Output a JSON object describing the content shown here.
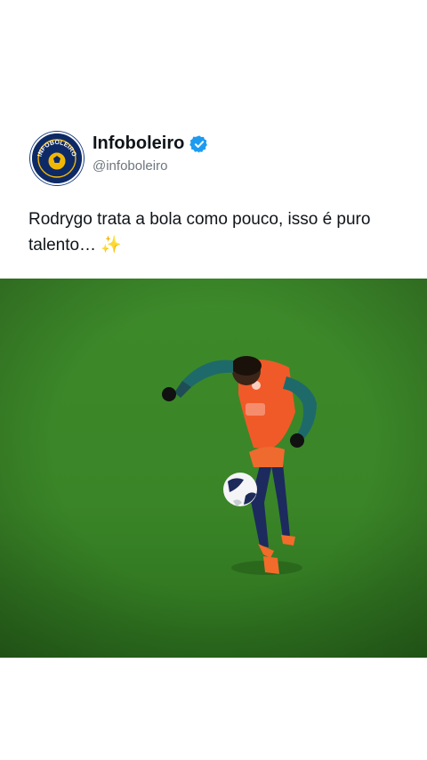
{
  "account": {
    "display_name": "Infoboleiro",
    "handle": "@infoboleiro",
    "verified": true,
    "avatar_icon": "infoboleiro-logo",
    "avatar_text": "INFOBOLEIRO"
  },
  "tweet": {
    "text": "Rodrygo trata a bola como pouco, isso é puro talento…",
    "emoji": "✨"
  },
  "media": {
    "description_icon": "football-player-juggling-image"
  },
  "colors": {
    "verified_badge": "#1d9bf0",
    "pitch_green": "#3f8a2b",
    "bib_orange": "#f05a28",
    "avatar_navy": "#0d2a66"
  }
}
